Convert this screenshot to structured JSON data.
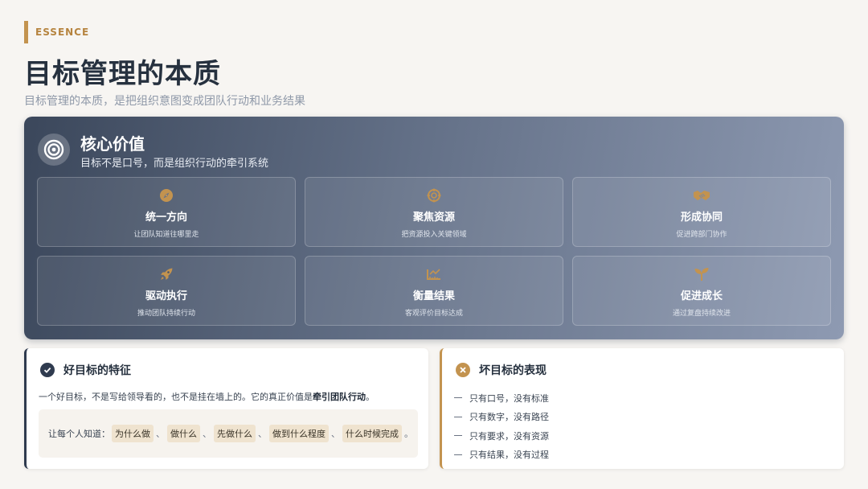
{
  "header": {
    "eyebrow": "ESSENCE",
    "title": "目标管理的本质",
    "subtitle": "目标管理的本质，是把组织意图变成团队行动和业务结果"
  },
  "core": {
    "icon": "target-icon",
    "title": "核心价值",
    "desc": "目标不是口号，而是组织行动的牵引系统",
    "cards": [
      {
        "icon": "compass-icon",
        "title": "统一方向",
        "desc": "让团队知道往哪里走"
      },
      {
        "icon": "crosshair-icon",
        "title": "聚焦资源",
        "desc": "把资源投入关键领域"
      },
      {
        "icon": "handshake-icon",
        "title": "形成协同",
        "desc": "促进跨部门协作"
      },
      {
        "icon": "rocket-icon",
        "title": "驱动执行",
        "desc": "推动团队持续行动"
      },
      {
        "icon": "ruler-icon",
        "title": "衡量结果",
        "desc": "客观评价目标达成"
      },
      {
        "icon": "seedling-icon",
        "title": "促进成长",
        "desc": "通过复盘持续改进"
      }
    ]
  },
  "good": {
    "icon": "check-circle-icon",
    "title": "好目标的特征",
    "text_before": "一个好目标，不是写给领导看的，也不是挂在墙上的。它的真正价值是",
    "text_bold": "牵引团队行动",
    "text_after": "。",
    "box_prefix": "让每个人知道：",
    "tags": [
      "为什么做",
      "做什么",
      "先做什么",
      "做到什么程度",
      "什么时候完成"
    ],
    "tag_separator": "、",
    "box_suffix": "。"
  },
  "bad": {
    "icon": "x-circle-icon",
    "title": "坏目标的表现",
    "items": [
      "只有口号，没有标准",
      "只有数字，没有路径",
      "只有要求，没有资源",
      "只有结果，没有过程"
    ]
  },
  "colors": {
    "accent": "#c3934f",
    "dark": "#2f3b4f",
    "background": "#f7f5f2"
  }
}
